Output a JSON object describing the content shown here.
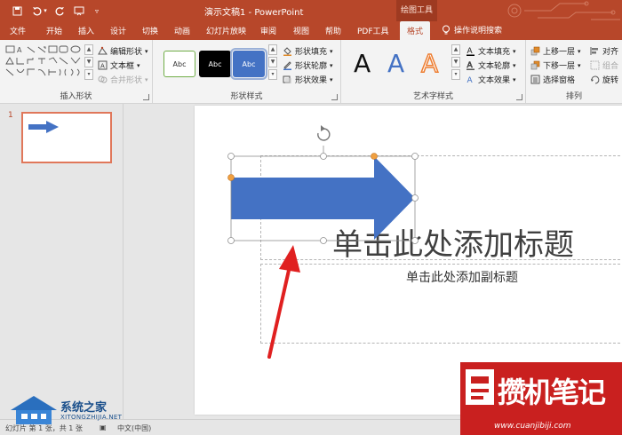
{
  "titlebar": {
    "doc_title": "演示文稿1 - PowerPoint",
    "context_tab_group": "绘图工具",
    "quick_access": [
      "save-icon",
      "undo-icon",
      "redo-icon",
      "start-slideshow-icon",
      "customize-icon"
    ]
  },
  "tabs": [
    {
      "label": "文件"
    },
    {
      "label": "开始"
    },
    {
      "label": "插入"
    },
    {
      "label": "设计"
    },
    {
      "label": "切换"
    },
    {
      "label": "动画"
    },
    {
      "label": "幻灯片放映"
    },
    {
      "label": "审阅"
    },
    {
      "label": "视图"
    },
    {
      "label": "帮助"
    },
    {
      "label": "PDF工具"
    },
    {
      "label": "格式",
      "active": true
    }
  ],
  "search": {
    "label": "操作说明搜索"
  },
  "ribbon": {
    "insert_shapes": {
      "label": "插入形状",
      "edit_shape": "编辑形状",
      "text_box": "文本框",
      "merge_shapes": "合并形状"
    },
    "shape_styles": {
      "label": "形状样式",
      "thumbs": [
        "Abc",
        "Abc",
        "Abc"
      ],
      "fill": "形状填充",
      "outline": "形状轮廓",
      "effects": "形状效果"
    },
    "wordart_styles": {
      "label": "艺术字样式",
      "samples": [
        "A",
        "A",
        "A"
      ],
      "text_fill": "文本填充",
      "text_outline": "文本轮廓",
      "text_effects": "文本效果"
    },
    "arrange": {
      "label": "排列",
      "bring_forward": "上移一层",
      "send_backward": "下移一层",
      "selection_pane": "选择窗格",
      "align": "对齐",
      "group": "组合",
      "rotate": "旋转"
    }
  },
  "thumbnails": {
    "slide_number": "1"
  },
  "slide": {
    "title_placeholder": "单击此处添加标题",
    "subtitle_placeholder": "单击此处添加副标题"
  },
  "statusbar": {
    "slide_info": "幻灯片 第 1 张，共 1 张",
    "language": "中文(中国)"
  },
  "watermarks": {
    "left_title": "系统之家",
    "left_url": "XITONGZHIJIA.NET",
    "right_title": "攒机笔记",
    "right_url": "www.cuanjibiji.com"
  },
  "colors": {
    "accent": "#b7472a",
    "shape_fill": "#4472c4",
    "annotation_arrow": "#e02020",
    "handle": "#f0a040"
  }
}
